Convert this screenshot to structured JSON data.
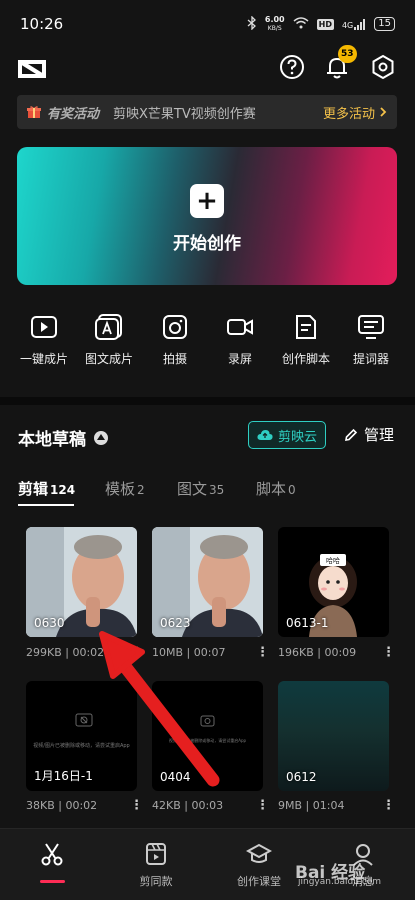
{
  "status": {
    "time": "10:26",
    "speed_value": "6.00",
    "speed_unit": "KB/S",
    "hd": "HD",
    "signal": "4G",
    "battery": "15"
  },
  "header": {
    "notification_count": "53"
  },
  "promo": {
    "tag": "有奖活动",
    "text": "剪映X芒果TV视频创作赛",
    "more": "更多活动"
  },
  "create": {
    "label": "开始创作"
  },
  "tools": [
    {
      "label": "一键成片",
      "icon": "play-square-icon"
    },
    {
      "label": "图文成片",
      "icon": "letter-a-icon"
    },
    {
      "label": "拍摄",
      "icon": "camera-icon"
    },
    {
      "label": "录屏",
      "icon": "video-record-icon"
    },
    {
      "label": "创作脚本",
      "icon": "document-icon"
    },
    {
      "label": "提词器",
      "icon": "teleprompter-icon"
    }
  ],
  "drafts": {
    "title": "本地草稿",
    "cloud_label": "剪映云",
    "manage_label": "管理",
    "tabs": [
      {
        "label": "剪辑",
        "count": "124"
      },
      {
        "label": "模板",
        "count": "2"
      },
      {
        "label": "图文",
        "count": "35"
      },
      {
        "label": "脚本",
        "count": "0"
      }
    ],
    "items": [
      {
        "name": "0630",
        "size": "299KB",
        "duration": "00:02"
      },
      {
        "name": "0623",
        "size": "10MB",
        "duration": "00:07"
      },
      {
        "name": "0613-1",
        "size": "196KB",
        "duration": "00:09"
      },
      {
        "name": "1月16日-1",
        "size": "38KB",
        "duration": "00:02",
        "thumb_text": "视频/图片已被删除或移动，请尝试重启App"
      },
      {
        "name": "0404",
        "size": "42KB",
        "duration": "00:03",
        "thumb_text": "视频/图片已被删除或移动，请尝试重启App"
      },
      {
        "name": "0612",
        "size": "9MB",
        "duration": "01:04"
      }
    ],
    "avatar_caption": "哈哈"
  },
  "bottom_nav": [
    {
      "label": "",
      "icon": "scissors-icon"
    },
    {
      "label": "剪同款",
      "icon": "template-icon"
    },
    {
      "label": "创作课堂",
      "icon": "graduation-cap-icon"
    },
    {
      "label": "消息",
      "icon": "message-icon"
    }
  ],
  "watermark": {
    "main": "Bai 经验",
    "sub": "jingyan.baidu.com"
  },
  "colors": {
    "accent": "#2fcfc3",
    "brand_red": "#fe2c55",
    "badge": "#f5b800",
    "promo_more": "#f5c24a"
  }
}
